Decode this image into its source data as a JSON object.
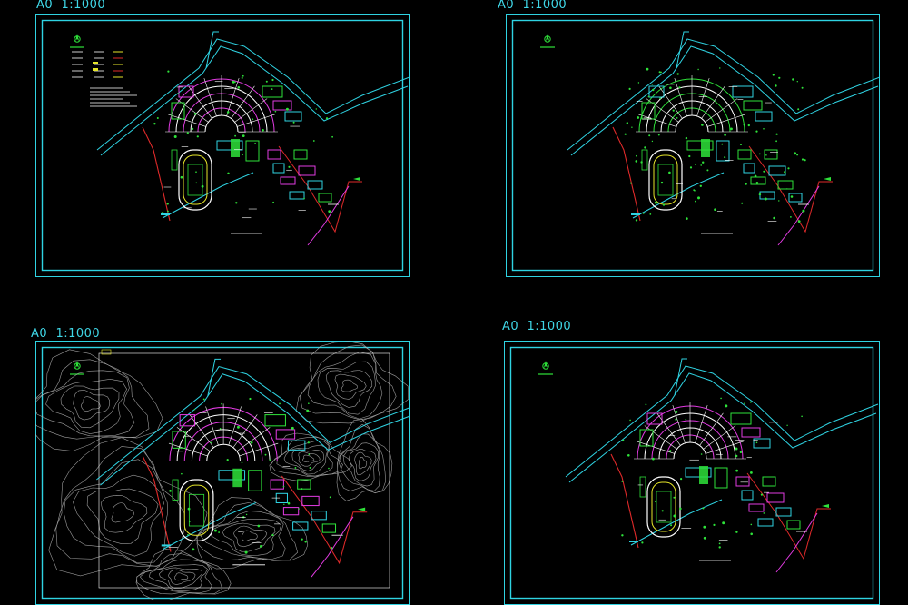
{
  "sheets": [
    {
      "id": "sheet-1",
      "paper": "A0",
      "scale": "1:1000",
      "variant": "legend"
    },
    {
      "id": "sheet-2",
      "paper": "A0",
      "scale": "1:1000",
      "variant": "dense"
    },
    {
      "id": "sheet-3",
      "paper": "A0",
      "scale": "1:1000",
      "variant": "topo"
    },
    {
      "id": "sheet-4",
      "paper": "A0",
      "scale": "1:1000",
      "variant": "plain"
    }
  ],
  "colors": {
    "frame": "#2fd3e2",
    "road": "#2fd3e2",
    "building_magenta": "#e23be2",
    "building_green": "#2ee23a",
    "boundary_red": "#e02a2a",
    "white": "#ffffff",
    "contour": "#b8b8b8",
    "yellow": "#e6e62a"
  }
}
